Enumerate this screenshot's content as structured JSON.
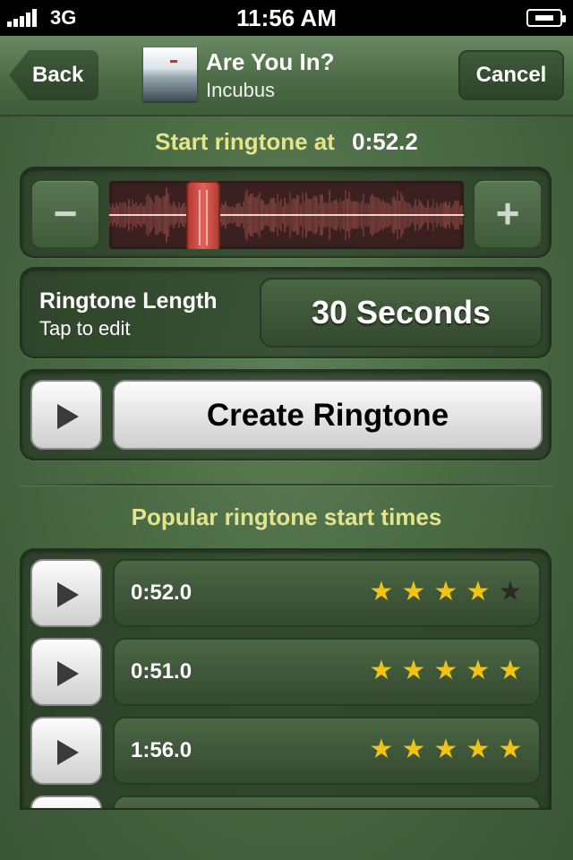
{
  "status_bar": {
    "carrier": "3G",
    "time": "11:56 AM"
  },
  "nav": {
    "back_label": "Back",
    "cancel_label": "Cancel",
    "song_title": "Are You In?",
    "song_artist": "Incubus"
  },
  "start": {
    "label": "Start ringtone at",
    "value": "0:52.2"
  },
  "scrubber": {
    "minus": "−",
    "plus": "+",
    "handle_position_fraction": 0.24
  },
  "length": {
    "title": "Ringtone Length",
    "subtitle": "Tap to edit",
    "value": "30 Seconds"
  },
  "create": {
    "label": "Create Ringtone"
  },
  "popular": {
    "header": "Popular ringtone start times",
    "items": [
      {
        "time": "0:52.0",
        "rating": 4,
        "max": 5
      },
      {
        "time": "0:51.0",
        "rating": 5,
        "max": 5
      },
      {
        "time": "1:56.0",
        "rating": 5,
        "max": 5
      }
    ]
  },
  "colors": {
    "accent_yellow": "#e2e58c",
    "star": "#f3c314",
    "waveform": "#c0605a"
  }
}
